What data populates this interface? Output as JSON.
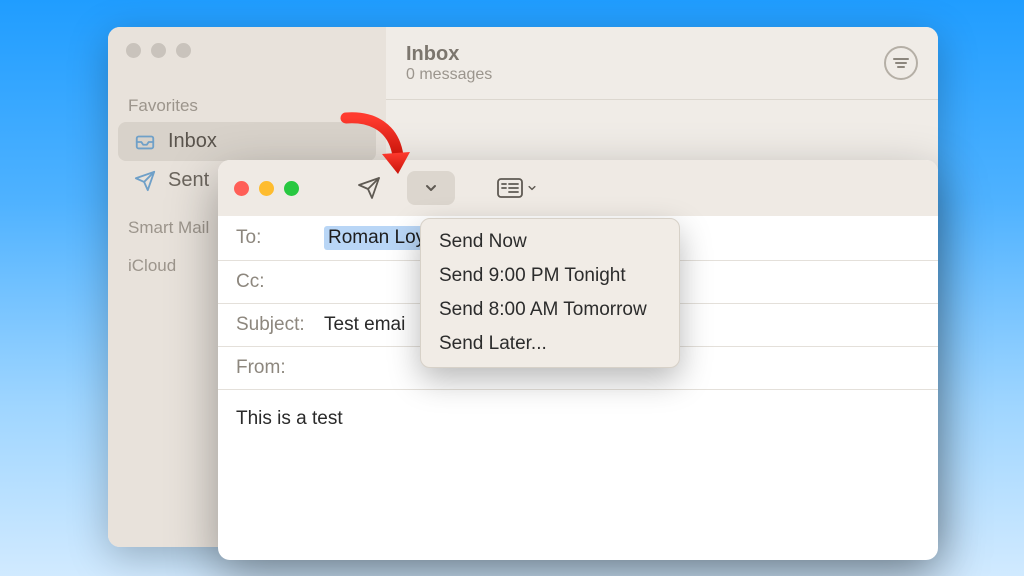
{
  "main_window": {
    "sidebar": {
      "favorites_label": "Favorites",
      "items": [
        {
          "id": "inbox",
          "label": "Inbox"
        },
        {
          "id": "sent",
          "label": "Sent"
        }
      ],
      "smart_label": "Smart Mail",
      "icloud_label": "iCloud"
    },
    "header": {
      "title": "Inbox",
      "subtitle": "0 messages"
    }
  },
  "compose": {
    "fields": {
      "to_label": "To:",
      "to_value": "Roman Loyola",
      "cc_label": "Cc:",
      "subject_label": "Subject:",
      "subject_value": "Test emai",
      "from_label": "From:"
    },
    "body": "This is a test"
  },
  "send_menu": {
    "items": [
      "Send Now",
      "Send 9:00 PM Tonight",
      "Send 8:00 AM Tomorrow",
      "Send Later..."
    ]
  }
}
